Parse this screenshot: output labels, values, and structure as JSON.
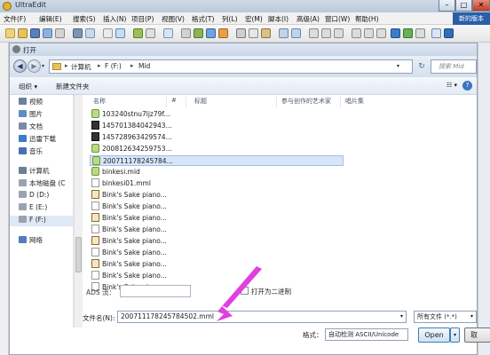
{
  "window": {
    "title": "UltraEdit",
    "min": "–",
    "max": "□",
    "close": "✕"
  },
  "menu": {
    "items": [
      "文件(F)",
      "编辑(E)",
      "搜索(S)",
      "插入(N)",
      "项目(P)",
      "视图(V)",
      "格式(T)",
      "列(L)",
      "宏(M)",
      "脚本(I)",
      "高级(A)",
      "窗口(W)",
      "帮助(H)"
    ],
    "right_label": "新的版本"
  },
  "dialog": {
    "title": "打开",
    "address": {
      "crumbs": [
        "计算机",
        "F (F:)",
        "Mid"
      ],
      "sep": "▸"
    },
    "search_placeholder": "搜索 Mid",
    "refresh_glyph": "↻",
    "back_glyph": "◀",
    "fwd_glyph": "▶",
    "organize": "组织 ▾",
    "new_folder": "新建文件夹",
    "view_glyph": "☷ ▾",
    "help_glyph": "?",
    "nav": [
      {
        "label": "视频",
        "color": "#6d7fa0"
      },
      {
        "label": "图片",
        "color": "#5d8fc7"
      },
      {
        "label": "文档",
        "color": "#7a8aa8"
      },
      {
        "label": "迅雷下载",
        "color": "#3c7cc9"
      },
      {
        "label": "音乐",
        "color": "#4b6fb5"
      },
      {
        "label": "计算机",
        "color": "#6b7f99"
      },
      {
        "label": "本地磁盘 (C",
        "color": "#9aa4b0"
      },
      {
        "label": "D (D:)",
        "color": "#9aa4b0"
      },
      {
        "label": "E (E:)",
        "color": "#9aa4b0"
      },
      {
        "label": "F (F:)",
        "color": "#9aa4b0"
      },
      {
        "label": "网络",
        "color": "#4f7fb8"
      }
    ],
    "columns": [
      "名称",
      "#",
      "标题",
      "参与创作的艺术家",
      "唱片集"
    ],
    "files": [
      {
        "name": "103240stnu7ljz79f...",
        "type": "green"
      },
      {
        "name": "145701384042943...",
        "type": "dark"
      },
      {
        "name": "145728963429574...",
        "type": "dark"
      },
      {
        "name": "200812634259753...",
        "type": "green"
      },
      {
        "name": "200711178245784...",
        "type": "green"
      },
      {
        "name": "binkesi.mid",
        "type": "green"
      },
      {
        "name": "binkesi01.mml",
        "type": "plain"
      },
      {
        "name": "Bink's Sake piano...",
        "type": "sake"
      },
      {
        "name": "Bink's Sake piano...",
        "type": "plain"
      },
      {
        "name": "Bink's Sake piano...",
        "type": "sake"
      },
      {
        "name": "Bink's Sake piano...",
        "type": "plain"
      },
      {
        "name": "Bink's Sake piano...",
        "type": "sake"
      },
      {
        "name": "Bink's Sake piano...",
        "type": "plain"
      },
      {
        "name": "Bink's Sake piano...",
        "type": "sake"
      },
      {
        "name": "Bink's Sake piano...",
        "type": "plain"
      },
      {
        "name": "Bink's Sake piano...",
        "type": "plain"
      }
    ],
    "ads_label": "ADS 流：",
    "binary_label": "打开为二进制",
    "filename_label": "文件名(N):",
    "filename_value": "200711178245784502.mml",
    "filter_value": "所有文件 (*.*)",
    "encoding_label": "格式：",
    "encoding_value": "自动检测 ASCII/Unicode",
    "open_label": "Open",
    "open_split_glyph": "▾",
    "cancel_label": "取"
  },
  "annotation": {
    "arrow_color": "#e040e0"
  }
}
